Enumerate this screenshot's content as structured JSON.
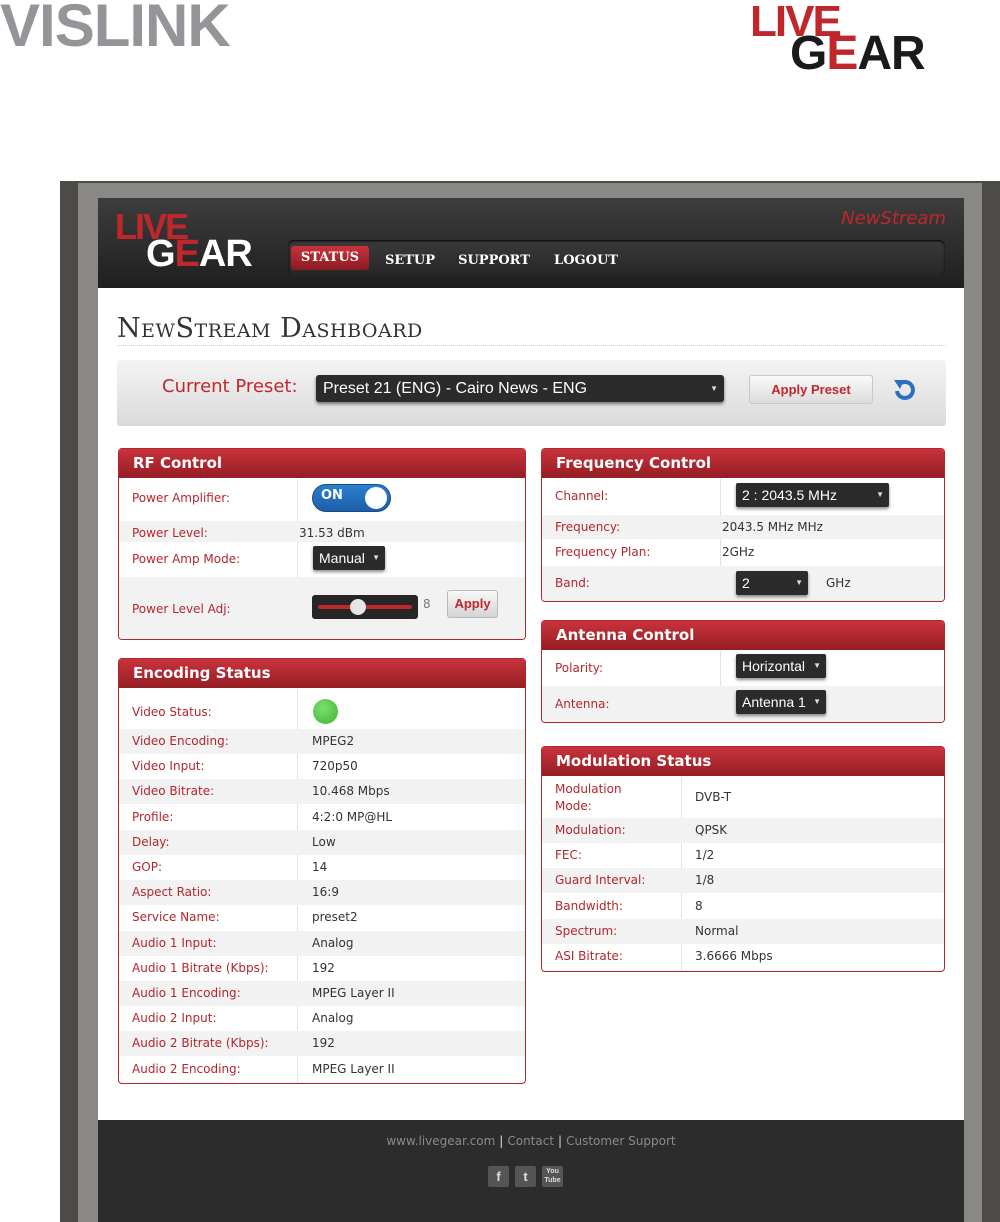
{
  "brand": {
    "vislink": "VISLINK",
    "livegear_live": "LIVE",
    "livegear_gear_g": "G",
    "livegear_gear_e": "E",
    "livegear_gear_ar": "AR",
    "product": "NewStream"
  },
  "nav": {
    "items": [
      "STATUS",
      "SETUP",
      "SUPPORT",
      "LOGOUT"
    ],
    "active": "STATUS"
  },
  "page_title": "NewStream Dashboard",
  "preset": {
    "label": "Current Preset:",
    "selected": "Preset 21 (ENG) - Cairo News - ENG",
    "apply_label": "Apply Preset"
  },
  "rf_control": {
    "title": "RF Control",
    "power_amplifier_label": "Power Amplifier:",
    "power_amplifier_value": "ON",
    "power_level_label": "Power Level:",
    "power_level_value": "31.53 dBm",
    "power_amp_mode_label": "Power Amp Mode:",
    "power_amp_mode_value": "Manual",
    "power_level_adj_label": "Power Level Adj:",
    "power_level_adj_value": "8",
    "apply_label": "Apply"
  },
  "encoding_status": {
    "title": "Encoding Status",
    "video_status_label": "Video Status:",
    "video_status_color": "#3fb432",
    "rows": [
      {
        "label": "Video Encoding:",
        "value": "MPEG2"
      },
      {
        "label": "Video Input:",
        "value": "720p50"
      },
      {
        "label": "Video Bitrate:",
        "value": "10.468 Mbps"
      },
      {
        "label": "Profile:",
        "value": "4:2:0 MP@HL"
      },
      {
        "label": "Delay:",
        "value": "Low"
      },
      {
        "label": "GOP:",
        "value": "14"
      },
      {
        "label": "Aspect Ratio:",
        "value": "16:9"
      },
      {
        "label": "Service Name:",
        "value": "preset2"
      },
      {
        "label": "Audio 1 Input:",
        "value": "Analog"
      },
      {
        "label": "Audio 1 Bitrate (Kbps):",
        "value": "192"
      },
      {
        "label": "Audio 1 Encoding:",
        "value": "MPEG Layer II"
      },
      {
        "label": "Audio 2 Input:",
        "value": "Analog"
      },
      {
        "label": "Audio 2 Bitrate (Kbps):",
        "value": "192"
      },
      {
        "label": "Audio 2 Encoding:",
        "value": "MPEG Layer II"
      }
    ]
  },
  "frequency_control": {
    "title": "Frequency Control",
    "channel_label": "Channel:",
    "channel_value": "2 : 2043.5 MHz",
    "frequency_label": "Frequency:",
    "frequency_value": "2043.5 MHz MHz",
    "frequency_plan_label": "Frequency Plan:",
    "frequency_plan_value": "2GHz",
    "band_label": "Band:",
    "band_value": "2",
    "band_unit": "GHz"
  },
  "antenna_control": {
    "title": "Antenna Control",
    "polarity_label": "Polarity:",
    "polarity_value": "Horizontal",
    "antenna_label": "Antenna:",
    "antenna_value": "Antenna 1"
  },
  "modulation_status": {
    "title": "Modulation Status",
    "mode_label_1": "Modulation",
    "mode_label_2": "Mode:",
    "mode_value": "DVB-T",
    "rows": [
      {
        "label": "Modulation:",
        "value": "QPSK"
      },
      {
        "label": "FEC:",
        "value": "1/2"
      },
      {
        "label": "Guard Interval:",
        "value": "1/8"
      },
      {
        "label": "Bandwidth:",
        "value": "8"
      },
      {
        "label": "Spectrum:",
        "value": "Normal"
      },
      {
        "label": "ASI Bitrate:",
        "value": "3.6666 Mbps"
      }
    ]
  },
  "footer": {
    "site": "www.livegear.com",
    "contact": "Contact",
    "support": "Customer Support",
    "separator": "|",
    "social": {
      "facebook": "f",
      "twitter": "t",
      "youtube": "You Tube"
    }
  },
  "colors": {
    "accent": "#c0272d",
    "toggle_on": "#2a7fd0"
  }
}
